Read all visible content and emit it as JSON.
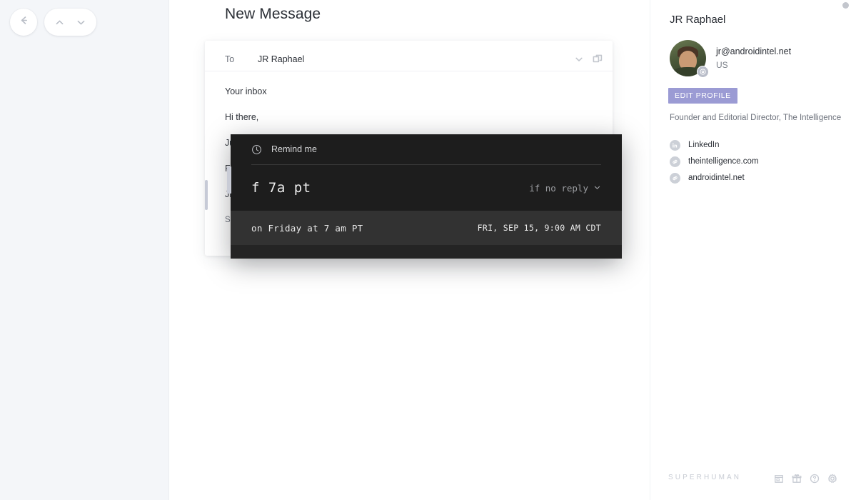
{
  "nav": {
    "back_icon": "arrow-left-icon",
    "up_icon": "chevron-up-icon",
    "down_icon": "chevron-down-icon"
  },
  "compose": {
    "title": "New Message",
    "to_label": "To",
    "to_value": "JR Raphael",
    "expand_icon": "chevron-down-icon",
    "popout_icon": "popout-window-icon",
    "body_lines": [
      "Your inbox",
      "Hi there,",
      "Just wanted to drop you a quick note to let you know how lovely your inbox has been looking lately.",
      "Fo",
      "JR",
      "Se"
    ]
  },
  "remind": {
    "header_label": "Remind me",
    "clock_icon": "clock-icon",
    "query": "f 7a pt",
    "filter_label": "if no reply",
    "filter_icon": "chevron-down-icon",
    "result_phrase": "on Friday at 7 am PT",
    "result_timestamp": "FRI, SEP 15, 9:00 AM CDT"
  },
  "sidebar": {
    "name": "JR Raphael",
    "email": "jr@androidintel.net",
    "region": "US",
    "edit_profile_label": "EDIT PROFILE",
    "job_title": "Founder and Editorial Director, The Intelligence",
    "avatar_badge_icon": "gear-badge-icon",
    "links": [
      {
        "label": "LinkedIn",
        "icon": "linkedin-icon"
      },
      {
        "label": "theintelligence.com",
        "icon": "link-icon"
      },
      {
        "label": "androidintel.net",
        "icon": "link-icon"
      }
    ]
  },
  "footer": {
    "brand": "SUPERHUMAN",
    "icons": [
      {
        "name": "calendar-icon"
      },
      {
        "name": "gift-icon"
      },
      {
        "name": "help-icon"
      },
      {
        "name": "settings-icon"
      }
    ]
  },
  "colors": {
    "overlay_bg": "#1d1d1d",
    "overlay_result_bg": "#323232",
    "accent_purple": "#9b9bd4",
    "rail_bg": "#f4f6f9"
  }
}
